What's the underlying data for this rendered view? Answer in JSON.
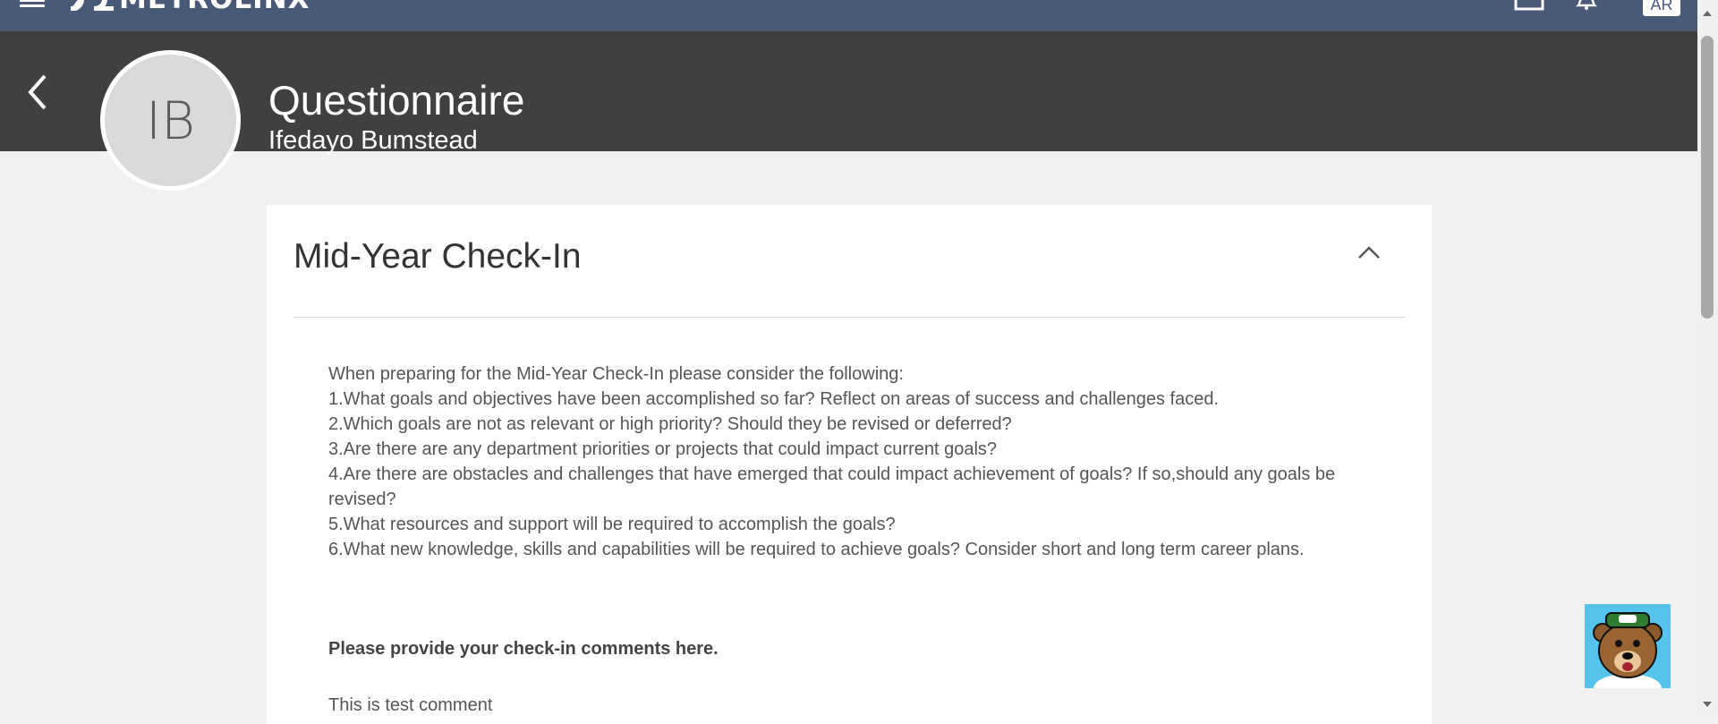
{
  "topnav": {
    "brand": "METROLINX",
    "menu_icon": "hamburger-menu-icon",
    "home_icon": "home-icon",
    "notifications_icon": "bell-icon",
    "user_initials": "AR",
    "color": "#485a78"
  },
  "profile": {
    "back_icon": "chevron-left-icon",
    "avatar_initials": "IB",
    "page_title": "Questionnaire",
    "person_name": "Ifedayo Bumstead",
    "band_color": "#404040"
  },
  "section": {
    "title": "Mid-Year Check-In",
    "collapse_icon": "chevron-up-icon",
    "guidance": [
      "When preparing for the Mid-Year Check-In please consider the following:",
      "1.What goals and objectives have been accomplished so far? Reflect on areas of success and challenges faced.",
      "2.Which goals are not as relevant or high priority? Should they be revised or deferred?",
      "3.Are there are any department priorities or projects that could impact current goals?",
      "4.Are there are obstacles and challenges that have emerged that could impact achievement of goals? If so,should any goals be revised?",
      "5.What resources and support will be required to accomplish the goals?",
      "6.What new knowledge, skills and capabilities will be required to achieve goals? Consider short and long term career plans."
    ],
    "comment_prompt": "Please provide your check-in comments here.",
    "comment_value": "This is test comment"
  },
  "assistant": {
    "icon": "bear-mascot-icon",
    "color": "#54c4ec"
  }
}
